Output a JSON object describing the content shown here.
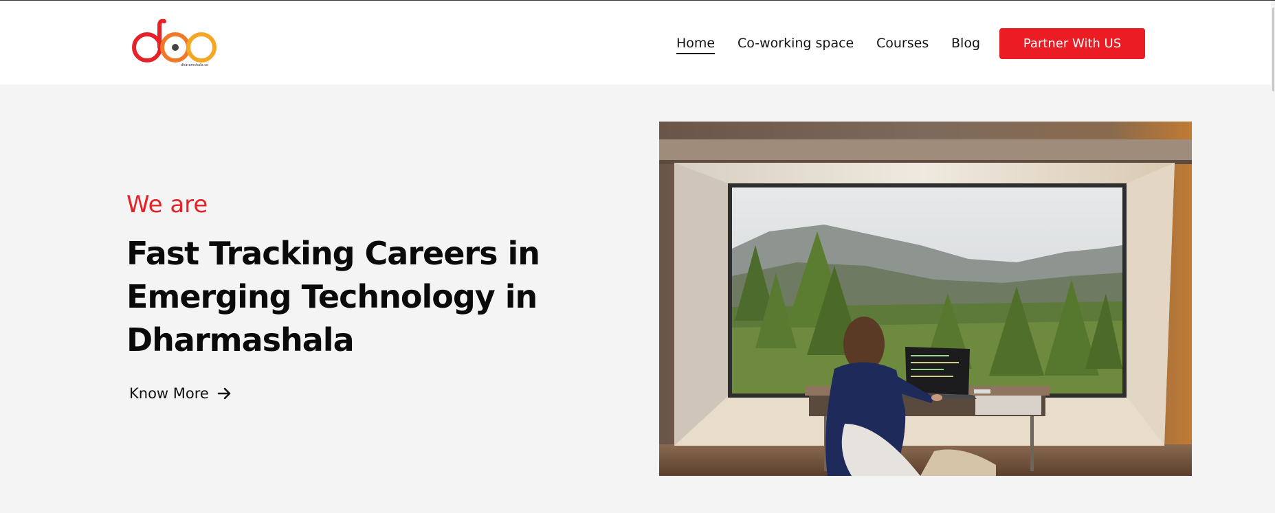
{
  "brand": {
    "logo_text": "dharamshala.co",
    "colors": {
      "red": "#e52228",
      "orange": "#f5a623",
      "dark": "#333333"
    }
  },
  "nav": {
    "items": [
      {
        "label": "Home",
        "active": true
      },
      {
        "label": "Co-working space"
      },
      {
        "label": "Courses"
      },
      {
        "label": "Blog"
      }
    ],
    "cta_label": "Partner With US"
  },
  "hero": {
    "eyebrow": "We are",
    "headline": "Fast Tracking Careers in Emerging Technology in Dharmashala",
    "link_label": "Know More",
    "link_icon": "arrow-right-icon",
    "image_subject": "woman-at-laptop-by-forest-window"
  },
  "colors": {
    "accent": "#ec1c24",
    "background": "#f4f4f4",
    "header_bg": "#ffffff",
    "text": "#111111"
  }
}
